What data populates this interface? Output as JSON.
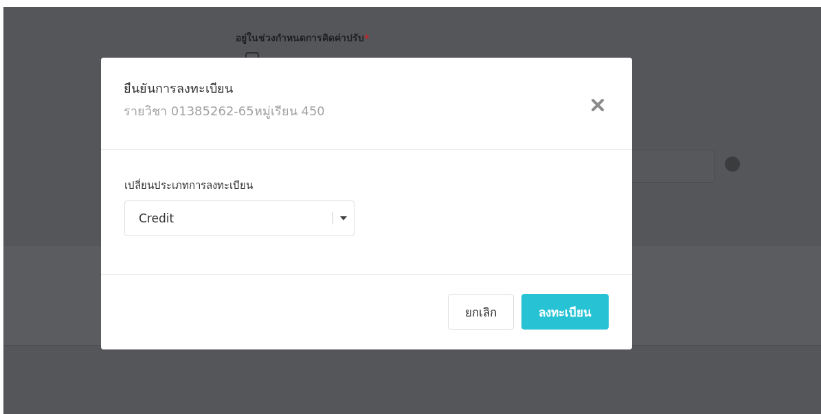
{
  "background": {
    "fine_label": "อยู่ในช่วงกำหนดการคิดค่าปรับ",
    "required_mark": "*",
    "checkbox_checked": false
  },
  "dialog": {
    "title": "ยืนยันการลงทะเบียน",
    "subtitle": "รายวิชา 01385262-65หมู่เรียน 450",
    "field_label": "เปลี่ยนประเภทการลงทะเบียน",
    "select_value": "Credit",
    "buttons": [
      {
        "label": "ยกเลิก",
        "kind": "secondary"
      },
      {
        "label": "ลงทะเบียน",
        "kind": "primary"
      }
    ]
  }
}
